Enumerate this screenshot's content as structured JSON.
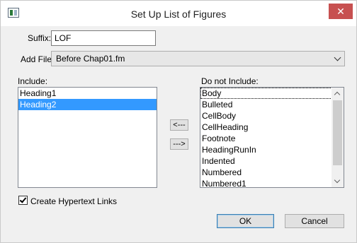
{
  "window": {
    "title": "Set Up List of Figures",
    "close_glyph": "✕",
    "icon": "app-icon"
  },
  "suffix": {
    "label": "Suffix:",
    "value": "LOF"
  },
  "add_file": {
    "label": "Add File:",
    "value": "Before Chap01.fm"
  },
  "include": {
    "label": "Include:",
    "items": [
      {
        "label": "Heading1",
        "selected": false
      },
      {
        "label": "Heading2",
        "selected": true
      }
    ]
  },
  "move_buttons": {
    "add": "<---",
    "remove": "--->"
  },
  "do_not_include": {
    "label": "Do not Include:",
    "items": [
      {
        "label": "Body",
        "focused": true
      },
      {
        "label": "Bulleted"
      },
      {
        "label": "CellBody"
      },
      {
        "label": "CellHeading"
      },
      {
        "label": "Footnote"
      },
      {
        "label": "HeadingRunIn"
      },
      {
        "label": "Indented"
      },
      {
        "label": "Numbered"
      },
      {
        "label": "Numbered1"
      }
    ]
  },
  "hypertext": {
    "label": "Create Hypertext Links",
    "checked": true
  },
  "buttons": {
    "ok": "OK",
    "cancel": "Cancel"
  },
  "colors": {
    "selection": "#3399ff",
    "close": "#c75050",
    "default_border": "#3c7fb1"
  }
}
